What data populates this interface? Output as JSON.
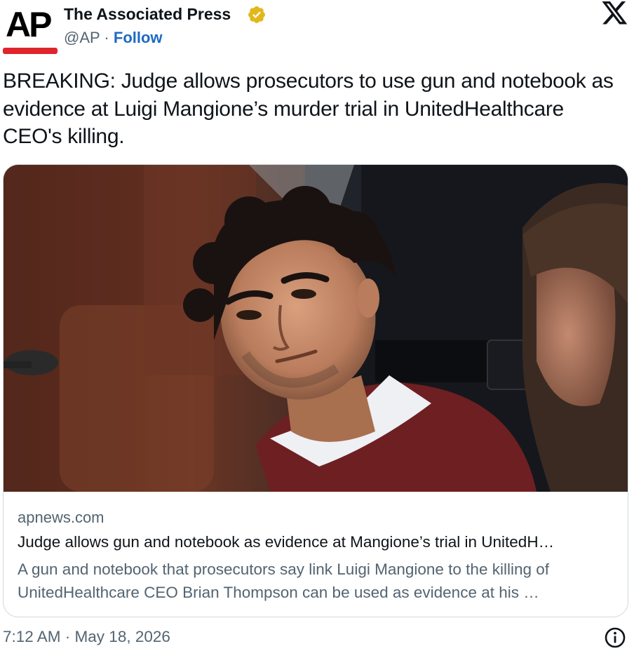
{
  "author": {
    "name": "The Associated Press",
    "handle": "@AP",
    "separator": "·",
    "follow_label": "Follow",
    "avatar_text": "AP",
    "verified_icon": "verified-gold-badge-icon"
  },
  "tweet": {
    "text": "BREAKING: Judge allows prosecutors to use gun and notebook as evidence at Luigi Mangione’s murder trial in UnitedHealthcare CEO's killing."
  },
  "card": {
    "domain": "apnews.com",
    "title": "Judge allows gun and notebook as evidence at Mangione’s trial in UnitedH…",
    "description": "A gun and notebook that prosecutors say link Luigi Mangione to the killing of UnitedHealthcare CEO Brian Thompson can be used as evidence at his …"
  },
  "footer": {
    "timestamp": "7:12 AM · May 18, 2026"
  },
  "colors": {
    "ap_red": "#e0242c",
    "verified_gold": "#e2b719",
    "link_blue": "#1d6ac4",
    "secondary_text": "#536471",
    "border": "#cfd9de"
  },
  "icons": [
    "x-logo-icon",
    "verified-badge-icon",
    "info-icon"
  ]
}
